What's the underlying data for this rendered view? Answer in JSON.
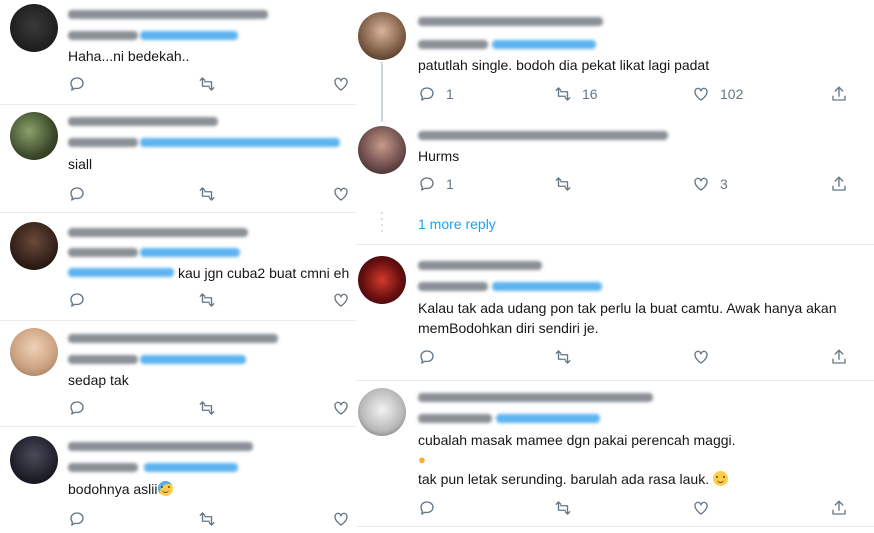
{
  "left_tweets": [
    {
      "text": "Haha...ni bedekah..",
      "text2": ""
    },
    {
      "text": "siall",
      "text2": ""
    },
    {
      "text": "kau jgn cuba2 buat cmni eh",
      "text2": ""
    },
    {
      "text": "sedap tak",
      "text2": ""
    },
    {
      "text": "bodohnya aslii",
      "text2": ""
    }
  ],
  "right_tweets": [
    {
      "text": "patutlah single. bodoh dia pekat likat lagi padat",
      "replies": "1",
      "retweets": "16",
      "likes": "102"
    },
    {
      "text": "Hurms",
      "replies": "1",
      "retweets": "",
      "likes": "3"
    },
    {
      "text": "Kalau tak ada udang pon tak perlu la buat camtu. Awak hanya akan",
      "text2": "memBodohkan diri sendiri je.",
      "replies": "",
      "retweets": "",
      "likes": ""
    },
    {
      "text": "cubalah masak mamee dgn pakai perencah maggi.",
      "text2": "tak pun letak serunding. barulah ada rasa lauk.",
      "replies": "",
      "retweets": "",
      "likes": ""
    }
  ],
  "more_reply_label": "1 more reply",
  "colors": {
    "link": "#1da1f2",
    "icon": "#657786",
    "divider": "#e6ecf0"
  }
}
